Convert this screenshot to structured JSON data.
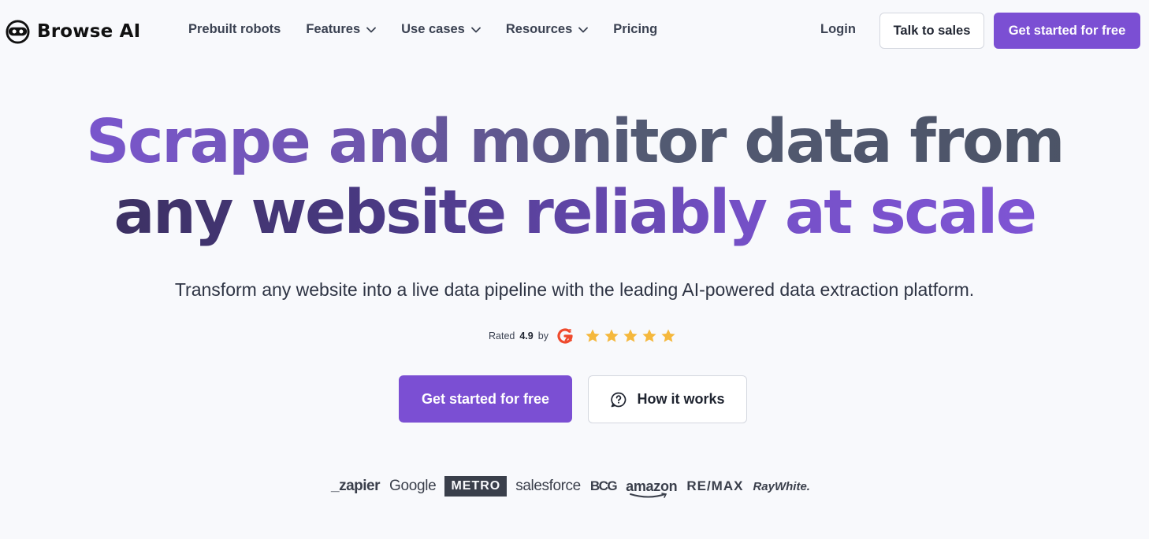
{
  "nav": {
    "logo_text": "Browse AI",
    "links": [
      {
        "label": "Prebuilt robots",
        "dropdown": false
      },
      {
        "label": "Features",
        "dropdown": true
      },
      {
        "label": "Use cases",
        "dropdown": true
      },
      {
        "label": "Resources",
        "dropdown": true
      },
      {
        "label": "Pricing",
        "dropdown": false
      }
    ],
    "login_label": "Login",
    "talk_to_sales_label": "Talk to sales",
    "get_started_label": "Get started for free"
  },
  "hero": {
    "headline_line1": "Scrape and monitor data from",
    "headline_line2": "any website reliably at scale",
    "subtitle": "Transform any website into a live data pipeline with the leading AI-powered data extraction platform.",
    "rating_prefix": "Rated",
    "rating_value": "4.9",
    "rating_suffix": "by",
    "stars": 5,
    "primary_cta": "Get started for free",
    "secondary_cta": "How it works"
  },
  "logos": {
    "zapier": "_zapier",
    "google": "Google",
    "metro": "METRO",
    "salesforce": "salesforce",
    "bcg": "BCG",
    "amazon": "amazon",
    "remax": "RE/MAX",
    "raywhite": "RayWhite."
  },
  "colors": {
    "brand_purple": "#7b4fd3",
    "star_gold": "#f5b83d",
    "g2_red": "#ef4a2d",
    "background": "#f8f9fc"
  }
}
